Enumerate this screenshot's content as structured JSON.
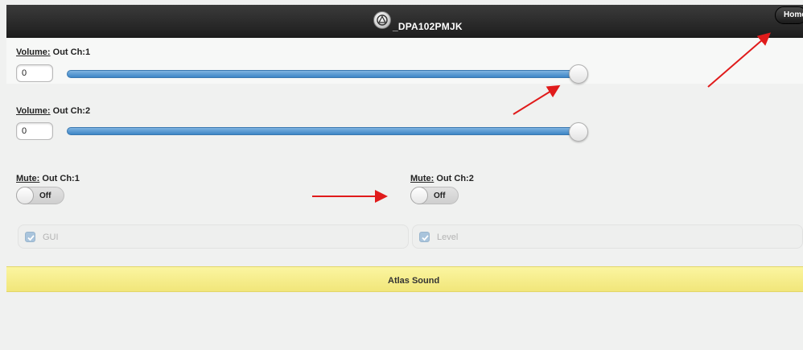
{
  "header": {
    "title": "_DPA102PMJK",
    "home_label": "Home"
  },
  "volume1": {
    "label_prefix": "Volume:",
    "label_channel": "Out Ch:1",
    "value": "0",
    "level": 1.0
  },
  "volume2": {
    "label_prefix": "Volume:",
    "label_channel": "Out Ch:2",
    "value": "0",
    "level": 1.0
  },
  "mute1": {
    "label_prefix": "Mute:",
    "label_channel": "Out Ch:1",
    "state": "Off"
  },
  "mute2": {
    "label_prefix": "Mute:",
    "label_channel": "Out Ch:2",
    "state": "Off"
  },
  "checkboxes": {
    "gui_label": "GUI",
    "level_label": "Level",
    "gui_checked": true,
    "level_checked": true
  },
  "footer": {
    "text": "Atlas Sound"
  },
  "colors": {
    "header_bg": "#1e1e1e",
    "slider_fill": "#3d86c6",
    "footer_bg": "#f1e67a",
    "annotation_arrow": "#e01b1b"
  }
}
